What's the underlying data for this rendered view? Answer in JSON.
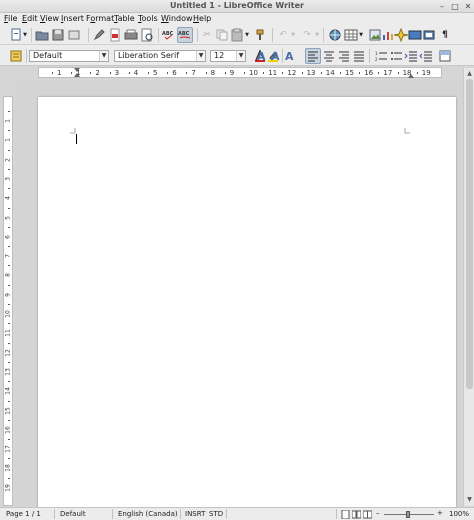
{
  "window": {
    "title": "Untitled 1 - LibreOffice Writer"
  },
  "menubar": {
    "items": [
      {
        "label": "File",
        "mnemonic": "F",
        "rest": "ile"
      },
      {
        "label": "Edit",
        "mnemonic": "E",
        "rest": "dit"
      },
      {
        "label": "View",
        "mnemonic": "V",
        "rest": "iew"
      },
      {
        "label": "Insert",
        "mnemonic": "I",
        "rest": "nsert"
      },
      {
        "label": "Format",
        "mnemonic": "o",
        "pre": "F",
        "rest": "rmat"
      },
      {
        "label": "Table",
        "mnemonic": "T",
        "rest": "able"
      },
      {
        "label": "Tools",
        "mnemonic": "T",
        "rest": "ools"
      },
      {
        "label": "Window",
        "mnemonic": "W",
        "rest": "indow"
      },
      {
        "label": "Help",
        "mnemonic": "H",
        "rest": "elp"
      }
    ]
  },
  "formatting": {
    "paragraph_style": "Default",
    "font_name": "Liberation Serif",
    "font_size": "12"
  },
  "ruler": {
    "horizontal_labels": [
      "1",
      "1",
      "2",
      "3",
      "4",
      "5",
      "6",
      "7",
      "8",
      "9",
      "10",
      "11",
      "12",
      "13",
      "14",
      "15",
      "16",
      "17",
      "18",
      "19"
    ],
    "vertical_labels": [
      "1",
      "1",
      "2",
      "3",
      "4",
      "5",
      "6",
      "7",
      "8",
      "9",
      "10",
      "11",
      "12",
      "13",
      "14",
      "15",
      "16",
      "17",
      "18",
      "19"
    ]
  },
  "statusbar": {
    "page": "Page 1 / 1",
    "style": "Default",
    "language": "English (Canada)",
    "insert_mode": "INSRT",
    "selection_mode": "STD",
    "zoom": "100%"
  },
  "colors": {
    "accent_pressed": "#c9d3df",
    "page": "#ffffff",
    "workspace": "#d4d4d4"
  }
}
